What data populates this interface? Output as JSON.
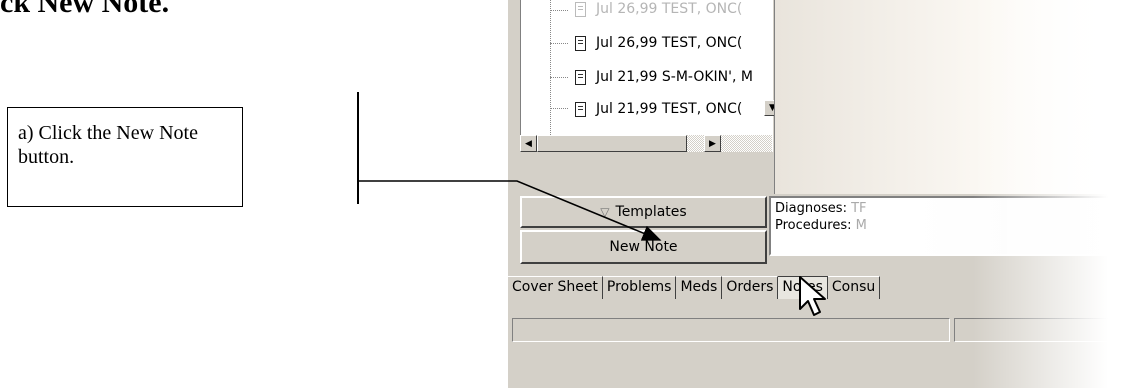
{
  "heading": "ck New Note.",
  "callout": {
    "text": "a) Click the New Note button."
  },
  "notes_tree": {
    "items": [
      {
        "date": "Jul 26,99",
        "author": "TEST, ONC("
      },
      {
        "date": "Jul 26,99",
        "author": "TEST, ONC("
      },
      {
        "date": "Jul 21,99",
        "author": "S-M-OKIN', M"
      },
      {
        "date": "Jul 21,99",
        "author": "TEST, ONC("
      }
    ]
  },
  "buttons": {
    "templates": "Templates",
    "new_note": "New Note"
  },
  "info": {
    "diagnoses_label": "Diagnoses:",
    "diagnoses_value": "TF",
    "procedures_label": "Procedures:",
    "procedures_value": "M"
  },
  "tabs": [
    {
      "label": "Cover Sheet"
    },
    {
      "label": "Problems"
    },
    {
      "label": "Meds"
    },
    {
      "label": "Orders"
    },
    {
      "label": "Notes",
      "active": true
    },
    {
      "label": "Consu"
    }
  ],
  "icons": {
    "scroll_down": "triangle-down-icon",
    "scroll_left": "triangle-left-icon",
    "scroll_right": "triangle-right-icon",
    "templates": "triangle-down-outline-icon",
    "cursor": "arrow-cursor-icon",
    "note": "document-icon"
  }
}
